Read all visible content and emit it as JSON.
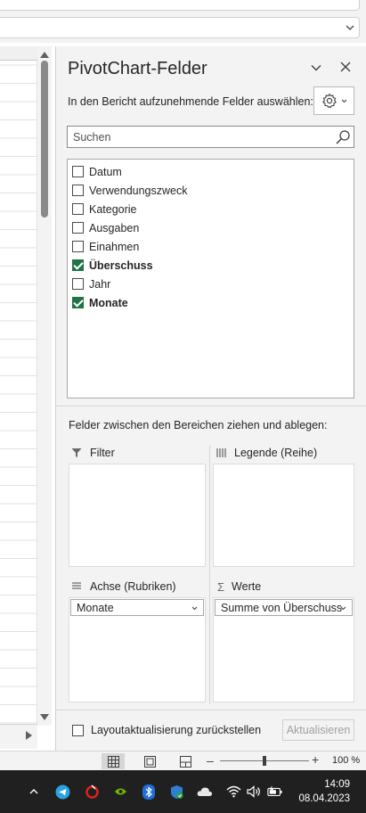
{
  "pane": {
    "title": "PivotChart-Felder",
    "subtitle": "In den Bericht aufzunehmende Felder auswählen:",
    "search_placeholder": "Suchen",
    "fields": [
      {
        "label": "Datum",
        "checked": false
      },
      {
        "label": "Verwendungszweck",
        "checked": false
      },
      {
        "label": "Kategorie",
        "checked": false
      },
      {
        "label": "Ausgaben",
        "checked": false
      },
      {
        "label": "Einahmen",
        "checked": false
      },
      {
        "label": "Überschuss",
        "checked": true
      },
      {
        "label": "Jahr",
        "checked": false
      },
      {
        "label": "Monate",
        "checked": true
      }
    ],
    "areas_label": "Felder zwischen den Bereichen ziehen und ablegen:",
    "areas": {
      "filter": {
        "label": "Filter"
      },
      "legend": {
        "label": "Legende (Reihe)"
      },
      "axis": {
        "label": "Achse (Rubriken)",
        "item": "Monate"
      },
      "values": {
        "label": "Werte",
        "item": "Summe von Überschuss"
      }
    },
    "defer_label": "Layoutaktualisierung zurückstellen",
    "update_label": "Aktualisieren"
  },
  "statusbar": {
    "zoom_minus": "–",
    "zoom_plus": "+",
    "zoom_level": "100 %",
    "zoom_value": 100
  },
  "taskbar": {
    "time": "14:09",
    "date": "08.04.2023"
  },
  "colors": {
    "accent_green": "#217346",
    "pane_bg": "#f3f3f3",
    "taskbar_bg": "#202020"
  }
}
